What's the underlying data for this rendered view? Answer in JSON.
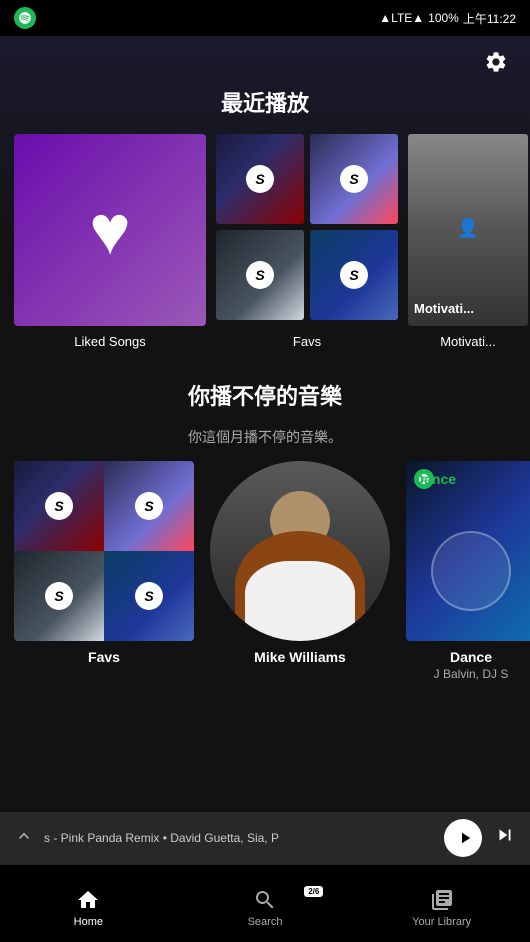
{
  "statusBar": {
    "carrier": "Spotify",
    "network": "LTE",
    "battery": "100%",
    "time": "上午11:22"
  },
  "header": {
    "gearLabel": "⚙"
  },
  "recentSection": {
    "title": "最近播放",
    "items": [
      {
        "id": "liked-songs",
        "label": "Liked Songs"
      },
      {
        "id": "favs",
        "label": "Favs"
      },
      {
        "id": "motivation",
        "label": "Motivati..."
      }
    ]
  },
  "nonstopSection": {
    "title": "你播不停的音樂",
    "subtitle": "你這個月播不停的音樂。",
    "items": [
      {
        "id": "favs",
        "label": "Favs",
        "sublabel": ""
      },
      {
        "id": "mike-williams",
        "label": "Mike Williams",
        "sublabel": ""
      },
      {
        "id": "dance",
        "label": "Dance",
        "sublabel": "J Balvin, DJ S"
      }
    ]
  },
  "player": {
    "trackInfo": "s - Pink Panda Remix • David Guetta, Sia, P",
    "pageIndicator": "2/6"
  },
  "bottomNav": {
    "items": [
      {
        "id": "home",
        "label": "Home",
        "icon": "🏠",
        "active": true
      },
      {
        "id": "search",
        "label": "Search",
        "icon": "🔍",
        "active": false
      },
      {
        "id": "library",
        "label": "Your Library",
        "icon": "📚",
        "active": false
      }
    ]
  }
}
